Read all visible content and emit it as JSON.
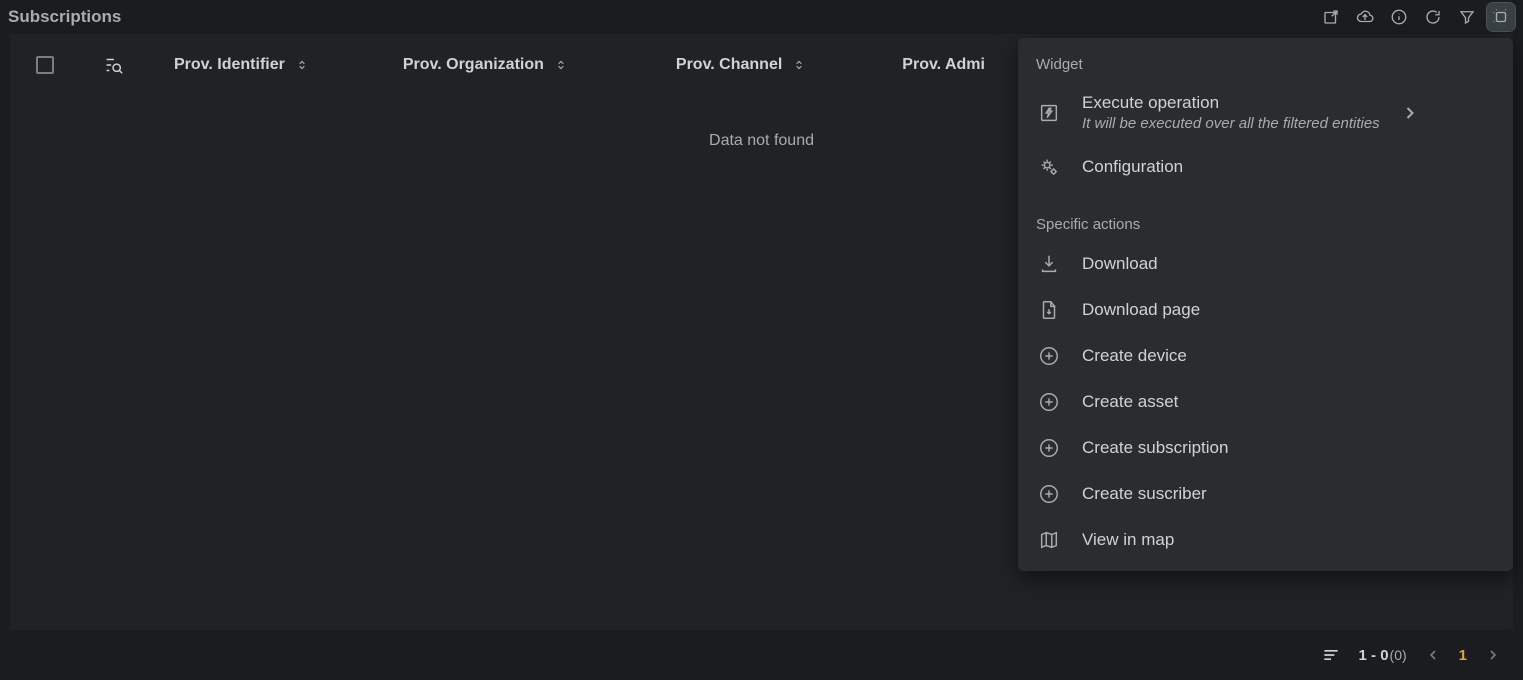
{
  "title": "Subscriptions",
  "columns": [
    "Prov. Identifier",
    "Prov. Organization",
    "Prov. Channel",
    "Prov. Admi"
  ],
  "empty_message": "Data not found",
  "footer": {
    "range": "1 - 0",
    "total": "(0)",
    "page": "1"
  },
  "menu": {
    "widget_title": "Widget",
    "execute": {
      "label": "Execute operation",
      "subtitle": "It will be executed over all the filtered entities"
    },
    "configuration": "Configuration",
    "specific_title": "Specific actions",
    "items": [
      "Download",
      "Download page",
      "Create device",
      "Create asset",
      "Create subscription",
      "Create suscriber",
      "View in map"
    ]
  }
}
